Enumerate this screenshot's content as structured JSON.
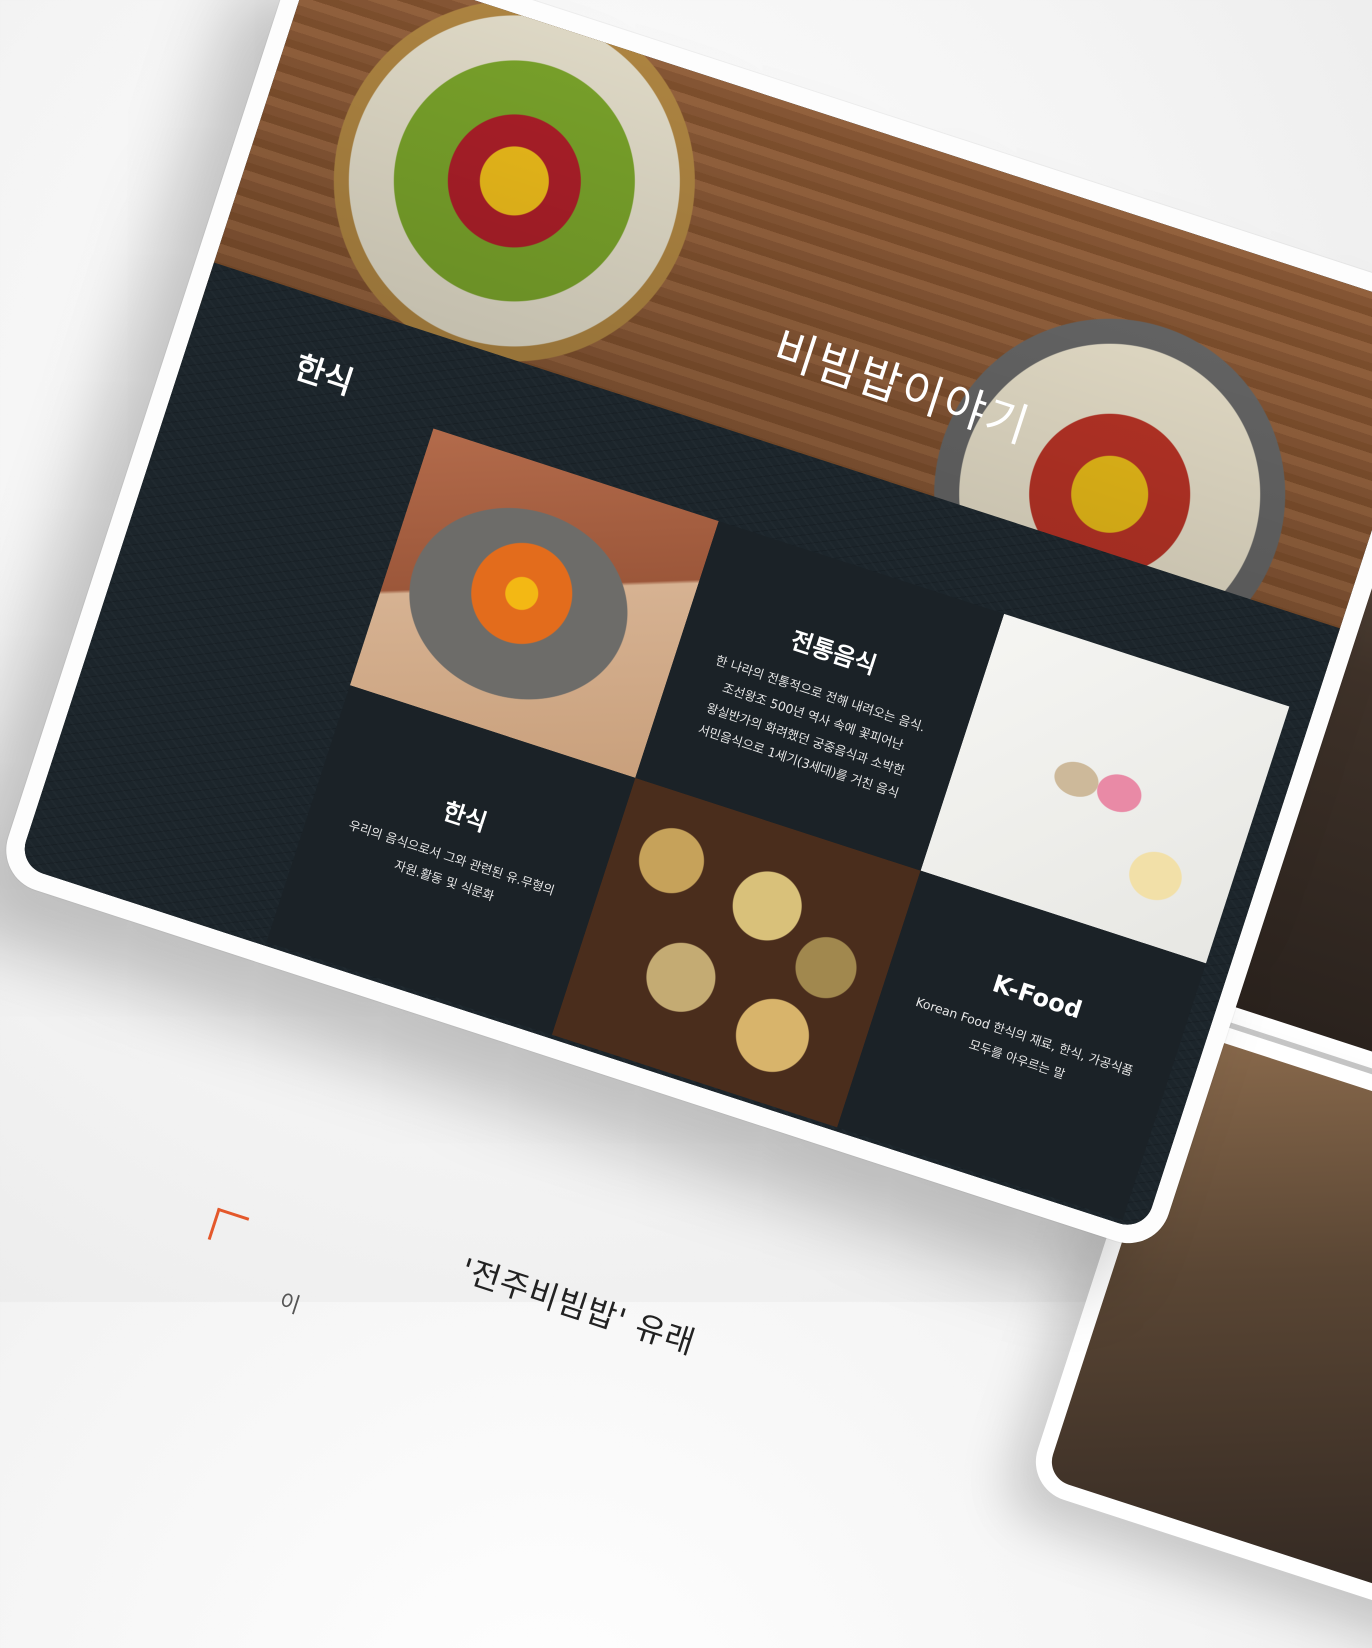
{
  "hero": {
    "title": "비빔밥이야기"
  },
  "section": {
    "title": "한식"
  },
  "tiles": {
    "traditional": {
      "heading": "전통음식",
      "text": "한 나라의 전통적으로 전해 내려오는 음식.\n조선왕조 500년 역사 속에 꽃피어난\n왕실반가의 화려했던 궁중음식과 소박한\n서민음식으로 1세기(3세대)를 거친 음식"
    },
    "hansik": {
      "heading": "한식",
      "text": "우리의 음식으로서 그와 관련된 유.무형의\n자원.활동 및 식문화"
    },
    "kfood": {
      "heading": "K-Food",
      "text": "Korean Food 한식의 재료, 한식, 가공식품\n모두를 아우르는 말"
    }
  },
  "caption": {
    "main": "'전주비빔밥' 유래",
    "sub": "이"
  },
  "colors": {
    "accent": "#e4582b",
    "dark": "#1c252b",
    "gold": "#e8a41a"
  }
}
